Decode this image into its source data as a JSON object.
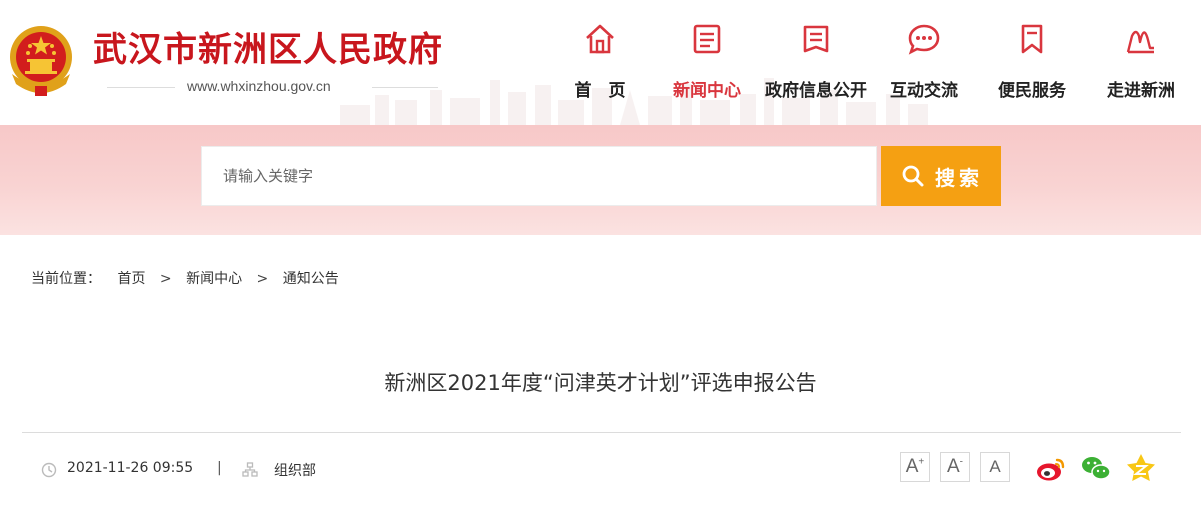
{
  "header": {
    "site_title": "武汉市新洲区人民政府",
    "site_url": "www.whxinzhou.gov.cn"
  },
  "nav": {
    "items": [
      {
        "label": "首　页",
        "icon": "home-icon",
        "active": false
      },
      {
        "label": "新闻中心",
        "icon": "news-icon",
        "active": true
      },
      {
        "label": "政府信息公开",
        "icon": "document-icon",
        "active": false
      },
      {
        "label": "互动交流",
        "icon": "chat-icon",
        "active": false
      },
      {
        "label": "便民服务",
        "icon": "bookmark-icon",
        "active": false
      },
      {
        "label": "走进新洲",
        "icon": "landmark-icon",
        "active": false
      }
    ]
  },
  "search": {
    "placeholder": "请输入关键字",
    "button_label": "搜索"
  },
  "breadcrumb": {
    "lead": "当前位置：",
    "items": [
      "首页",
      "新闻中心",
      "通知公告"
    ],
    "separator": ">"
  },
  "article": {
    "title": "新洲区2021年度“问津英才计划”评选申报公告",
    "date": "2021-11-26 09:55",
    "divider": "|",
    "source": "组织部"
  },
  "font_controls": [
    "A+",
    "A",
    "A"
  ],
  "share": [
    "weibo-icon",
    "wechat-icon",
    "qzone-icon"
  ],
  "colors": {
    "brand_red": "#c8161d",
    "active_nav": "#d9363e",
    "search_button": "#f5a012",
    "band_pink": "#f8cccc"
  }
}
